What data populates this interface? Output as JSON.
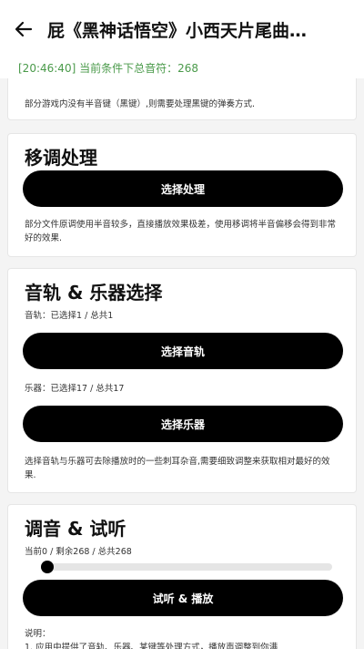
{
  "header": {
    "title": "屁《黑神话悟空》小西天片尾曲…",
    "status": "[20:46:40] 当前条件下总音符：268"
  },
  "partial_card": {
    "note": "部分游戏内没有半音键（黑键）,则需要处理黑键的弹奏方式."
  },
  "transpose": {
    "title": "移调处理",
    "button_label": "选择处理",
    "description": "部分文件原调使用半音较多，直接播放效果极差，使用移调将半音偏移会得到非常好的效果."
  },
  "tracks": {
    "title": "音轨 & 乐器选择",
    "track_info": "音轨：已选择1 / 总共1",
    "track_button": "选择音轨",
    "instrument_info": "乐器：已选择17 / 总共17",
    "instrument_button": "选择乐器",
    "description": "选择音轨与乐器可去除播放时的一些刺耳杂音,需要细致调整来获取相对最好的效果."
  },
  "tuning": {
    "title": "调音 & 试听",
    "progress_text": "当前0 / 剩余268 / 总共268",
    "progress": {
      "current": 0,
      "total": 268
    },
    "play_button": "试听 & 播放",
    "note_label": "说明：",
    "note_line1": "1. 应用中提供了音轨、乐器、某键等处理方式，播放声调整到你满"
  },
  "colors": {
    "accent_green": "#4a9a4a",
    "button_bg": "#000000"
  },
  "icons": {
    "back": "arrow-left-icon"
  }
}
